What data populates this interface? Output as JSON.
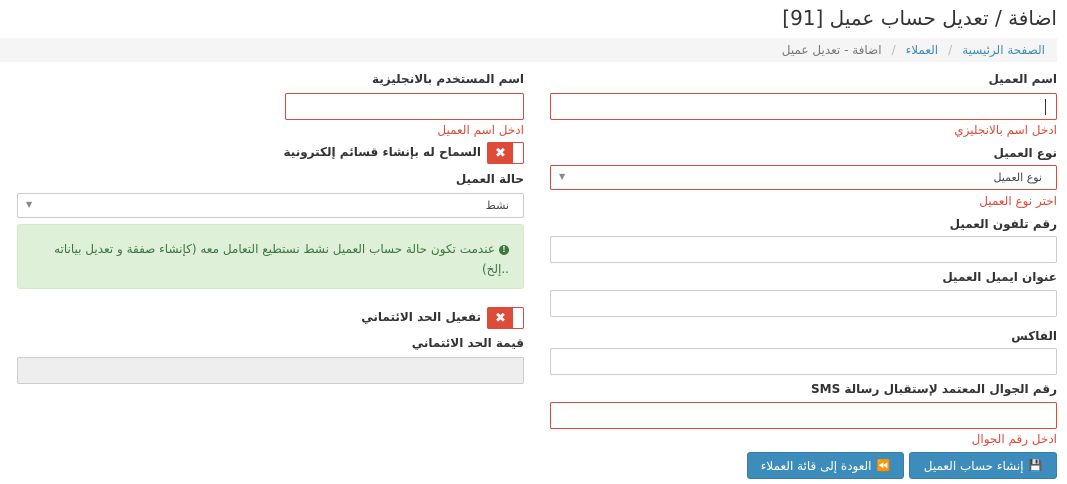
{
  "page": {
    "title": "اضافة / تعديل حساب عميل [91]"
  },
  "breadcrumb": {
    "home": "الصفحة الرئيسية",
    "customers": "العملاء",
    "current": "اضافة - تعديل عميل"
  },
  "form": {
    "customer_name": {
      "label": "اسم العميل",
      "value": "",
      "error": "ادخل اسم بالانجليزي"
    },
    "username_en": {
      "label": "اسم المستخدم بالانجليزية",
      "value": "",
      "error": "ادخل اسم العميل"
    },
    "customer_type": {
      "label": "نوع العميل",
      "selected": "نوع العميل",
      "error": "اختر نوع العميل"
    },
    "allow_invoices": {
      "label": "السماح له بإنشاء قسائم إلكترونية",
      "state": "off"
    },
    "customer_status": {
      "label": "حالة العميل",
      "selected": "نشط"
    },
    "status_alert": "عندمت تكون حالة حساب العميل نشط نستطيع التعامل معه (كإنشاء صفقة و تعديل بياناته ..إلخ)",
    "phone": {
      "label": "رقم تلفون العميل",
      "value": ""
    },
    "email": {
      "label": "عنوان ايميل العميل",
      "value": ""
    },
    "credit_enable": {
      "label": "تفعيل الحد الائتماني",
      "state": "off"
    },
    "credit_value": {
      "label": "قيمة الحد الائتماني",
      "value": ""
    },
    "fax": {
      "label": "الفاكس",
      "value": ""
    },
    "sms_mobile": {
      "label": "رقم الجوال المعتمد لإستقبال رسالة SMS",
      "value": "",
      "error": "ادخل رقم الجوال"
    }
  },
  "buttons": {
    "create": "إنشاء حساب العميل",
    "back": "العودة إلى قائة العملاء"
  },
  "icons": {
    "toggle_off": "x-icon",
    "alert": "exclamation-circle-icon",
    "save": "floppy-disk-icon",
    "back": "fast-backward-icon"
  },
  "colors": {
    "primary": "#3c8dbc",
    "danger": "#dd4b39",
    "success_bg": "#dff0d8",
    "success_text": "#3c763d"
  }
}
